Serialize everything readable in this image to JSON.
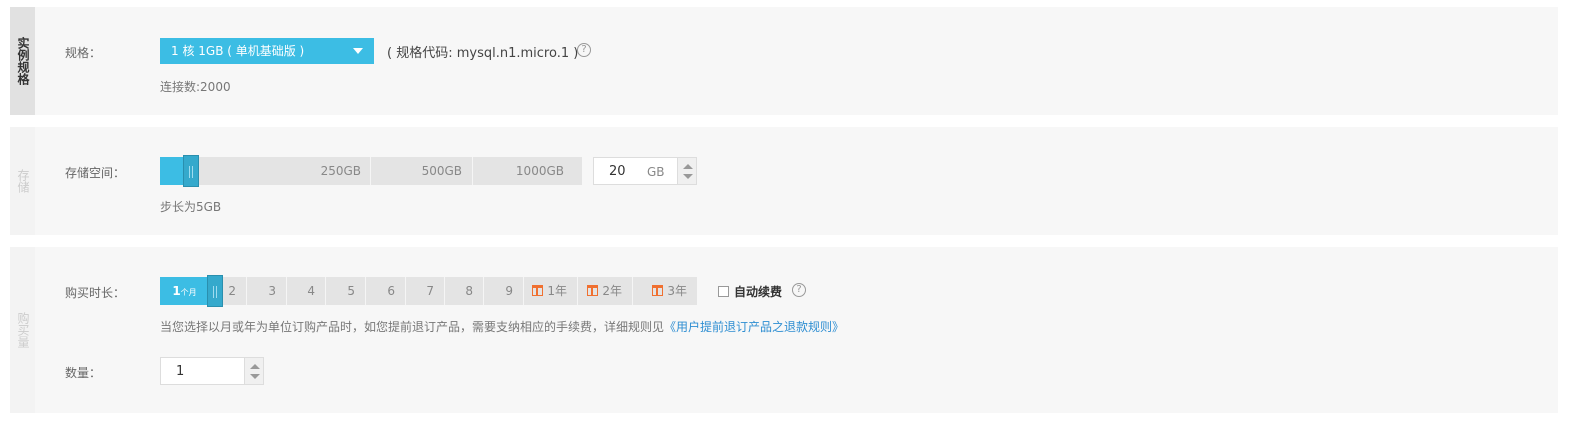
{
  "instance_spec": {
    "tab": "实例规格",
    "label": "规格：",
    "selected": "1 核 1GB ( 单机基础版 )",
    "code_text": "( 规格代码: mysql.n1.micro.1 )",
    "help": "?",
    "connections": "连接数:2000"
  },
  "storage": {
    "tab": "存储",
    "label": "存储空间：",
    "ticks": [
      "250GB",
      "500GB",
      "1000GB"
    ],
    "value": "20",
    "unit": "GB",
    "step_hint": "步长为5GB",
    "accent": "#3cbde4"
  },
  "purchase": {
    "tab": "购买量",
    "duration_label": "购买时长：",
    "selected_num": "1",
    "selected_unit": "个月",
    "months": [
      "2",
      "3",
      "4",
      "5",
      "6",
      "7",
      "8",
      "9"
    ],
    "years": [
      "1年",
      "2年",
      "3年"
    ],
    "auto_renew": "自动续费",
    "help": "?",
    "notice": "当您选择以月或年为单位订购产品时，如您提前退订产品，需要支纳相应的手续费，详细规则见",
    "notice_link": "《用户提前退订产品之退款规则》",
    "qty_label": "数量：",
    "qty_value": "1"
  }
}
